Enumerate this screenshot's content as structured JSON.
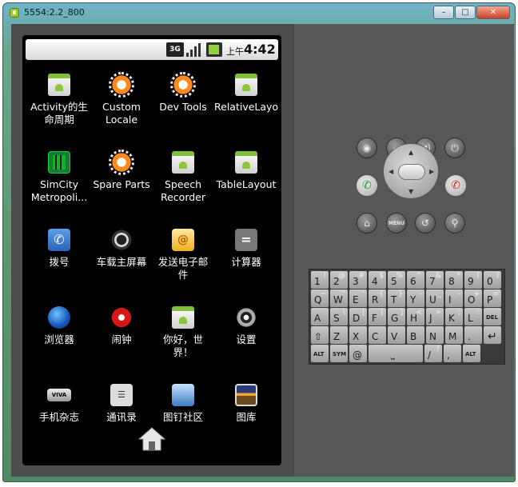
{
  "window": {
    "title": "5554:2.2_800",
    "buttons": {
      "minimize": "–",
      "maximize": "□",
      "close": "✕"
    }
  },
  "statusbar": {
    "network": "3G",
    "ampm": "上午",
    "time": "4:42"
  },
  "apps": [
    {
      "icon": "android-icon",
      "label_line1": "Activity的生",
      "label_line2": "命周期"
    },
    {
      "icon": "gear-icon",
      "label_line1": "Custom",
      "label_line2": "Locale"
    },
    {
      "icon": "gear-icon",
      "label_line1": "Dev Tools",
      "label_line2": ""
    },
    {
      "icon": "android-icon",
      "label_line1": "RelativeLayo",
      "label_line2": ""
    },
    {
      "icon": "simcity-icon",
      "label_line1": "SimCity",
      "label_line2": "Metropoli..."
    },
    {
      "icon": "gear-icon",
      "label_line1": "Spare Parts",
      "label_line2": ""
    },
    {
      "icon": "android-icon",
      "label_line1": "Speech",
      "label_line2": "Recorder"
    },
    {
      "icon": "android-icon",
      "label_line1": "TableLayout",
      "label_line2": ""
    },
    {
      "icon": "phone-icon",
      "label_line1": "拨号",
      "label_line2": ""
    },
    {
      "icon": "steering-wheel-icon",
      "label_line1": "车载主屏幕",
      "label_line2": ""
    },
    {
      "icon": "mail-icon",
      "label_line1": "发送电子邮",
      "label_line2": "件"
    },
    {
      "icon": "calculator-icon",
      "label_line1": "计算器",
      "label_line2": ""
    },
    {
      "icon": "globe-icon",
      "label_line1": "浏览器",
      "label_line2": ""
    },
    {
      "icon": "alarm-clock-icon",
      "label_line1": "闹钟",
      "label_line2": ""
    },
    {
      "icon": "android-icon",
      "label_line1": "你好，世",
      "label_line2": "界！"
    },
    {
      "icon": "settings-icon",
      "label_line1": "设置",
      "label_line2": ""
    },
    {
      "icon": "vivo-icon",
      "label_line1": "手机杂志",
      "label_line2": ""
    },
    {
      "icon": "contacts-icon",
      "label_line1": "通讯录",
      "label_line2": ""
    },
    {
      "icon": "photos-icon",
      "label_line1": "图钉社区",
      "label_line2": ""
    },
    {
      "icon": "gallery-icon",
      "label_line1": "图库",
      "label_line2": ""
    }
  ],
  "controls": {
    "menu_label": "MENU"
  },
  "keyboard": {
    "row1": [
      {
        "main": "1",
        "alt": "!"
      },
      {
        "main": "2",
        "alt": "@"
      },
      {
        "main": "3",
        "alt": "#"
      },
      {
        "main": "4",
        "alt": "$"
      },
      {
        "main": "5",
        "alt": "%"
      },
      {
        "main": "6",
        "alt": "^"
      },
      {
        "main": "7",
        "alt": "&"
      },
      {
        "main": "8",
        "alt": "*"
      },
      {
        "main": "9",
        "alt": "("
      },
      {
        "main": "0",
        "alt": ")"
      }
    ],
    "row2": [
      {
        "main": "Q",
        "alt": "~"
      },
      {
        "main": "W",
        "alt": "\""
      },
      {
        "main": "E",
        "alt": "'"
      },
      {
        "main": "R",
        "alt": "{"
      },
      {
        "main": "T",
        "alt": "}"
      },
      {
        "main": "Y",
        "alt": "-"
      },
      {
        "main": "U",
        "alt": "_"
      },
      {
        "main": "I",
        "alt": "-"
      },
      {
        "main": "O",
        "alt": "+"
      },
      {
        "main": "P",
        "alt": "="
      }
    ],
    "row3": [
      {
        "main": "A",
        "alt": ""
      },
      {
        "main": "S",
        "alt": "\\"
      },
      {
        "main": "D",
        "alt": "|"
      },
      {
        "main": "F",
        "alt": "["
      },
      {
        "main": "G",
        "alt": "]"
      },
      {
        "main": "H",
        "alt": "<"
      },
      {
        "main": "J",
        "alt": ">"
      },
      {
        "main": "K",
        "alt": ";"
      },
      {
        "main": "L",
        "alt": ":"
      },
      {
        "main": "DEL",
        "alt": ""
      }
    ],
    "row4": [
      {
        "main": "⇧",
        "alt": ""
      },
      {
        "main": "Z",
        "alt": ""
      },
      {
        "main": "X",
        "alt": ""
      },
      {
        "main": "C",
        "alt": ""
      },
      {
        "main": "V",
        "alt": ""
      },
      {
        "main": "B",
        "alt": ""
      },
      {
        "main": "N",
        "alt": ""
      },
      {
        "main": "M",
        "alt": ""
      },
      {
        "main": ".",
        "alt": ""
      },
      {
        "main": "↵",
        "alt": ""
      }
    ],
    "row5": {
      "alt_left": "ALT",
      "sym": "SYM",
      "at": "@",
      "space": "⎵",
      "slash": "/",
      "slash_alt": "?",
      "comma": ",",
      "alt_right": "ALT"
    }
  }
}
